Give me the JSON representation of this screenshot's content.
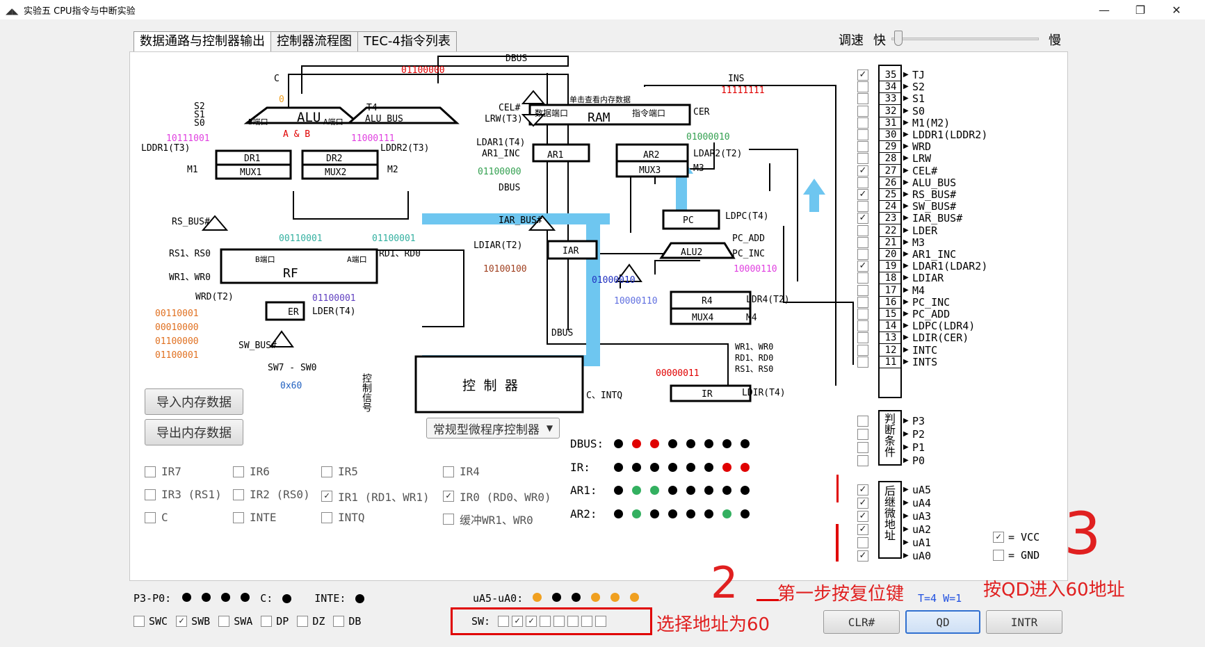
{
  "window": {
    "title": "实验五 CPU指令与中断实验",
    "min_icon": "—",
    "max_icon": "❐",
    "close_icon": "✕"
  },
  "tabs": [
    "数据通路与控制器输出",
    "控制器流程图",
    "TEC-4指令列表"
  ],
  "speed": {
    "label": "调速",
    "fast": "快",
    "slow": "慢",
    "value": 0.02
  },
  "diagram": {
    "dbus_top": "DBUS",
    "dbus_val": "01100000",
    "ins": "INS",
    "ins_val": "11111111",
    "alu": "ALU",
    "alu_b": "B端口",
    "alu_a": "A端口",
    "alu_op": "A & B",
    "c": "C",
    "c_val": "0",
    "s2": "S2",
    "s1": "S1",
    "s0": "S0",
    "t4": "T4",
    "alu_bus": "ALU_BUS",
    "dr1_val": "10111001",
    "dr2_val": "11000111",
    "lddr1": "LDDR1(T3)",
    "lddr2": "LDDR2(T3)",
    "dr1": "DR1",
    "dr2": "DR2",
    "mux1": "MUX1",
    "mux2": "MUX2",
    "m1": "M1",
    "m2": "M2",
    "rs_bus": "RS_BUS#",
    "rf_b_val": "00110001",
    "rf_a_val": "01100001",
    "rs1rs0": "RS1、RS0",
    "rd1rd0": "RD1、RD0",
    "wr1wr0": "WR1、WR0",
    "rf": "RF",
    "rf_b": "B端口",
    "rf_a": "A端口",
    "wrd": "WRD(T2)",
    "er_val": "01100001",
    "er": "ER",
    "lder": "LDER(T4)",
    "regs": [
      "00110001",
      "00010000",
      "01100000",
      "01100001"
    ],
    "sw_bus": "SW_BUS#",
    "sw7sw0": "SW7 - SW0",
    "sw_val": "0x60",
    "ram_click": "单击查看内存数据",
    "cel": "CEL#",
    "lrw": "LRW(T3)",
    "data_port": "数据端口",
    "ram": "RAM",
    "instr_port": "指令端口",
    "cer": "CER",
    "ldar1": "LDAR1(T4)",
    "ar1_inc": "AR1_INC",
    "ar1": "AR1",
    "ar1_val": "01100000",
    "dbus_mid": "DBUS",
    "ar2": "AR2",
    "mux3": "MUX3",
    "ldar2": "LDAR2(T2)",
    "m3": "M3",
    "ar2_val": "01000010",
    "iar_bus": "IAR_BUS#",
    "ldiar": "LDIAR(T2)",
    "iar": "IAR",
    "iar_val": "10100100",
    "pc": "PC",
    "ldpc": "LDPC(T4)",
    "alu2": "ALU2",
    "pc_add": "PC_ADD",
    "pc_inc": "PC_INC",
    "alu2_val": "10000110",
    "bus_val": "01000010",
    "r4_val": "10000110",
    "r4": "R4",
    "mux4": "MUX4",
    "ldr4": "LDR4(T2)",
    "m4": "M4",
    "dbus_bot": "DBUS",
    "ctrl_sig": "控制信号",
    "ctrl": "控 制 器",
    "ctrl_val": "00000011",
    "c_intq": "C、INTQ",
    "ir": "IR",
    "ldir": "LDIR(T4)",
    "ir_sig1": "WR1、WR0",
    "ir_sig2": "RD1、RD0",
    "ir_sig3": "RS1、RS0"
  },
  "import_btn": "导入内存数据",
  "export_btn": "导出内存数据",
  "ctrl_select": "常规型微程序控制器",
  "ir_bits": [
    {
      "label": "IR7",
      "checked": false
    },
    {
      "label": "IR6",
      "checked": false
    },
    {
      "label": "IR5",
      "checked": false
    },
    {
      "label": "IR4",
      "checked": false
    },
    {
      "label": "IR3 (RS1)",
      "checked": false
    },
    {
      "label": "IR2 (RS0)",
      "checked": false
    },
    {
      "label": "IR1 (RD1、WR1)",
      "checked": true
    },
    {
      "label": "IR0 (RD0、WR0)",
      "checked": true
    },
    {
      "label": "C",
      "checked": false
    },
    {
      "label": "INTE",
      "checked": false
    },
    {
      "label": "INTQ",
      "checked": false
    },
    {
      "label": "缓冲WR1、WR0",
      "checked": false
    }
  ],
  "leds": {
    "dbus": {
      "label": "DBUS:",
      "colors": [
        "#000",
        "#e00000",
        "#e00000",
        "#000",
        "#000",
        "#000",
        "#000",
        "#000"
      ]
    },
    "ir": {
      "label": "IR:",
      "colors": [
        "#000",
        "#000",
        "#000",
        "#000",
        "#000",
        "#000",
        "#e00000",
        "#e00000"
      ]
    },
    "ar1": {
      "label": "AR1:",
      "colors": [
        "#000",
        "#33b060",
        "#33b060",
        "#000",
        "#000",
        "#000",
        "#000",
        "#000"
      ]
    },
    "ar2": {
      "label": "AR2:",
      "colors": [
        "#000",
        "#33b060",
        "#000",
        "#000",
        "#000",
        "#000",
        "#33b060",
        "#000"
      ]
    }
  },
  "status": {
    "p_label": "P3-P0:",
    "c_label": "C:",
    "inte_label": "INTE:",
    "ua_label": "uA5-uA0:",
    "ua_colors": [
      "#f0a020",
      "#000",
      "#000",
      "#f0a020",
      "#f0a020",
      "#f0a020"
    ]
  },
  "switches": [
    {
      "label": "SWC",
      "checked": false
    },
    {
      "label": "SWB",
      "checked": true
    },
    {
      "label": "SWA",
      "checked": false
    },
    {
      "label": "DP",
      "checked": false
    },
    {
      "label": "DZ",
      "checked": false
    },
    {
      "label": "DB",
      "checked": false
    }
  ],
  "sw": {
    "label": "SW:",
    "bits": [
      false,
      true,
      true,
      false,
      false,
      false,
      false,
      false
    ]
  },
  "signals": [
    {
      "n": "35",
      "name": "TJ",
      "checked": true
    },
    {
      "n": "34",
      "name": "S2",
      "checked": false
    },
    {
      "n": "33",
      "name": "S1",
      "checked": false
    },
    {
      "n": "32",
      "name": "S0",
      "checked": false
    },
    {
      "n": "31",
      "name": "M1(M2)",
      "checked": false
    },
    {
      "n": "30",
      "name": "LDDR1(LDDR2)",
      "checked": false
    },
    {
      "n": "29",
      "name": "WRD",
      "checked": false
    },
    {
      "n": "28",
      "name": "LRW",
      "checked": false
    },
    {
      "n": "27",
      "name": "CEL#",
      "checked": true
    },
    {
      "n": "26",
      "name": "ALU_BUS",
      "checked": false
    },
    {
      "n": "25",
      "name": "RS_BUS#",
      "checked": true
    },
    {
      "n": "24",
      "name": "SW_BUS#",
      "checked": false
    },
    {
      "n": "23",
      "name": "IAR_BUS#",
      "checked": true
    },
    {
      "n": "22",
      "name": "LDER",
      "checked": false
    },
    {
      "n": "21",
      "name": "M3",
      "checked": false
    },
    {
      "n": "20",
      "name": "AR1_INC",
      "checked": false
    },
    {
      "n": "19",
      "name": "LDAR1(LDAR2)",
      "checked": true
    },
    {
      "n": "18",
      "name": "LDIAR",
      "checked": false
    },
    {
      "n": "17",
      "name": "M4",
      "checked": false
    },
    {
      "n": "16",
      "name": "PC_INC",
      "checked": false
    },
    {
      "n": "15",
      "name": "PC_ADD",
      "checked": false
    },
    {
      "n": "14",
      "name": "LDPC(LDR4)",
      "checked": false
    },
    {
      "n": "13",
      "name": "LDIR(CER)",
      "checked": false
    },
    {
      "n": "12",
      "name": "INTC",
      "checked": false
    },
    {
      "n": "11",
      "name": "INTS",
      "checked": false
    }
  ],
  "cond": {
    "label": "判断条件",
    "items": [
      {
        "name": "P3",
        "checked": false
      },
      {
        "name": "P2",
        "checked": false
      },
      {
        "name": "P1",
        "checked": false
      },
      {
        "name": "P0",
        "checked": false
      }
    ]
  },
  "next": {
    "label": "后继微地址",
    "items": [
      {
        "name": "uA5",
        "checked": true
      },
      {
        "name": "uA4",
        "checked": true
      },
      {
        "name": "uA3",
        "checked": true
      },
      {
        "name": "uA2",
        "checked": true
      },
      {
        "name": "uA1",
        "checked": false
      },
      {
        "name": "uA0",
        "checked": true
      }
    ]
  },
  "vcc": {
    "label": "= VCC",
    "checked": true
  },
  "gnd": {
    "label": "= GND",
    "checked": false
  },
  "timing": "T=4  W=1",
  "buttons": {
    "clr": "CLR#",
    "qd": "QD",
    "intr": "INTR"
  },
  "annotations": {
    "a1": "选择地址为60",
    "a2": "第一步按复位键",
    "a3": "按QD进入60地址",
    "n2": "2",
    "n3": "3"
  }
}
